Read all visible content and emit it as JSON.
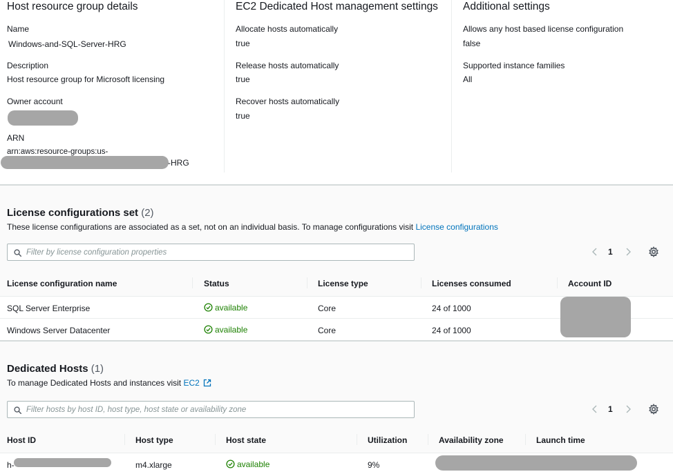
{
  "details": {
    "host_resource_group": {
      "title": "Host resource group details",
      "name_label": "Name",
      "name_value": "Windows-and-SQL-Server-HRG",
      "description_label": "Description",
      "description_value": "Host resource group for Microsoft licensing",
      "owner_label": "Owner account",
      "arn_label": "ARN",
      "arn_line1": "arn:aws:resource-groups:us-",
      "arn_suffix": "-HRG"
    },
    "ec2_settings": {
      "title": "EC2 Dedicated Host management settings",
      "allocate_label": "Allocate hosts automatically",
      "allocate_value": "true",
      "release_label": "Release hosts automatically",
      "release_value": "true",
      "recover_label": "Recover hosts automatically",
      "recover_value": "true"
    },
    "additional": {
      "title": "Additional settings",
      "license_config_label": "Allows any host based license configuration",
      "license_config_value": "false",
      "families_label": "Supported instance families",
      "families_value": "All"
    }
  },
  "license_section": {
    "title": "License configurations set",
    "count": "(2)",
    "description": "These license configurations are associated as a set, not on an individual basis. To manage configurations visit",
    "description_link": "License configurations",
    "filter_placeholder": "Filter by license configuration properties",
    "page": "1",
    "columns": [
      "License configuration name",
      "Status",
      "License type",
      "Licenses consumed",
      "Account ID"
    ],
    "rows": [
      {
        "name": "SQL Server Enterprise",
        "status": "available",
        "license_type": "Core",
        "consumed": "24 of 1000"
      },
      {
        "name": "Windows Server Datacenter",
        "status": "available",
        "license_type": "Core",
        "consumed": "24 of 1000"
      }
    ]
  },
  "hosts_section": {
    "title": "Dedicated Hosts",
    "count": "(1)",
    "description": "To manage Dedicated Hosts and instances visit",
    "description_link": "EC2",
    "filter_placeholder": "Filter hosts by host ID, host type, host state or availability zone",
    "page": "1",
    "columns": [
      "Host ID",
      "Host type",
      "Host state",
      "Utilization",
      "Availability zone",
      "Launch time"
    ],
    "rows": [
      {
        "host_id_prefix": "h-",
        "host_type": "m4.xlarge",
        "host_state": "available",
        "utilization": "9%"
      }
    ]
  },
  "colors": {
    "link": "#0073bb",
    "status_available": "#1d8102",
    "redaction": "#a6a6a6"
  },
  "icons": [
    "search-icon",
    "chevron-left-icon",
    "chevron-right-icon",
    "settings-gear-icon",
    "check-circle-icon",
    "external-link-icon"
  ]
}
